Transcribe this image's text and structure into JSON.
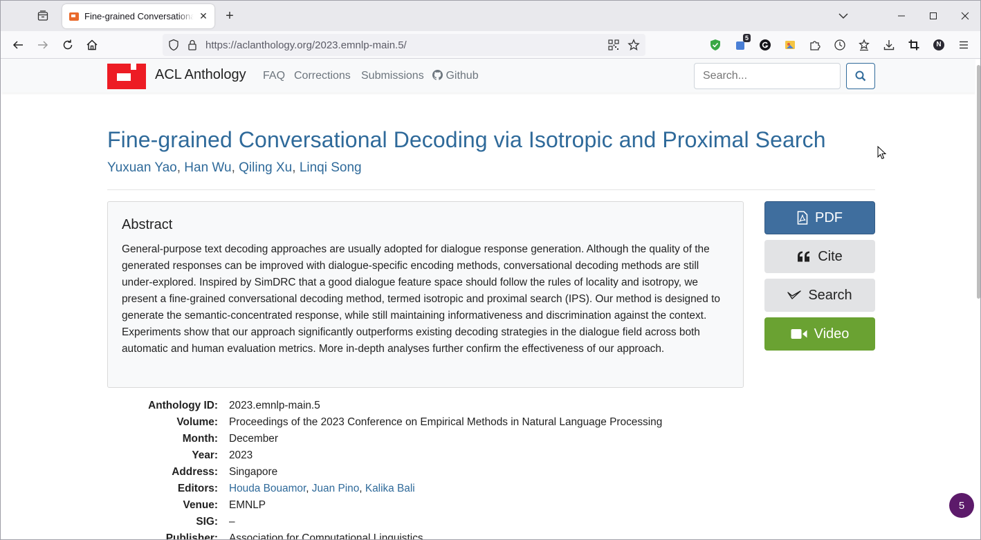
{
  "browser": {
    "tab_title": "Fine-grained Conversational Decoding via Isotropic and Proximal Search - ACL Anthology",
    "url_host": "https://aclanthology.org",
    "url_path": "/2023.emnlp-main.5/",
    "extension_badge": "5",
    "profile_initial": "N"
  },
  "site": {
    "brand": "ACL Anthology",
    "nav": [
      "FAQ",
      "Corrections",
      "Submissions",
      "Github"
    ],
    "search_placeholder": "Search..."
  },
  "paper": {
    "title": "Fine-grained Conversational Decoding via Isotropic and Proximal Search",
    "authors": [
      "Yuxuan Yao",
      "Han Wu",
      "Qiling Xu",
      "Linqi Song"
    ],
    "abstract_heading": "Abstract",
    "abstract": "General-purpose text decoding approaches are usually adopted for dialogue response generation. Although the quality of the generated responses can be improved with dialogue-specific encoding methods, conversational decoding methods are still under-explored. Inspired by SimDRC that a good dialogue feature space should follow the rules of locality and isotropy, we present a fine-grained conversational decoding method, termed isotropic and proximal search (IPS). Our method is designed to generate the semantic-concentrated response, while still maintaining informativeness and discrimination against the context. Experiments show that our approach significantly outperforms existing decoding strategies in the dialogue field across both automatic and human evaluation metrics. More in-depth analyses further confirm the effectiveness of our approach."
  },
  "actions": {
    "pdf": "PDF",
    "cite": "Cite",
    "search": "Search",
    "video": "Video"
  },
  "meta": {
    "anthology_id_label": "Anthology ID:",
    "anthology_id": "2023.emnlp-main.5",
    "volume_label": "Volume:",
    "volume": "Proceedings of the 2023 Conference on Empirical Methods in Natural Language Processing",
    "month_label": "Month:",
    "month": "December",
    "year_label": "Year:",
    "year": "2023",
    "address_label": "Address:",
    "address": "Singapore",
    "editors_label": "Editors:",
    "editors": [
      "Houda Bouamor",
      "Juan Pino",
      "Kalika Bali"
    ],
    "venue_label": "Venue:",
    "venue": "EMNLP",
    "sig_label": "SIG:",
    "sig": "–",
    "publisher_label": "Publisher:",
    "publisher": "Association for Computational Linguistics"
  },
  "floating_badge": "5",
  "colors": {
    "link": "#2f6a9a",
    "pdf": "#3f6e9e",
    "video": "#6aa232",
    "logo": "#ed1c24"
  }
}
